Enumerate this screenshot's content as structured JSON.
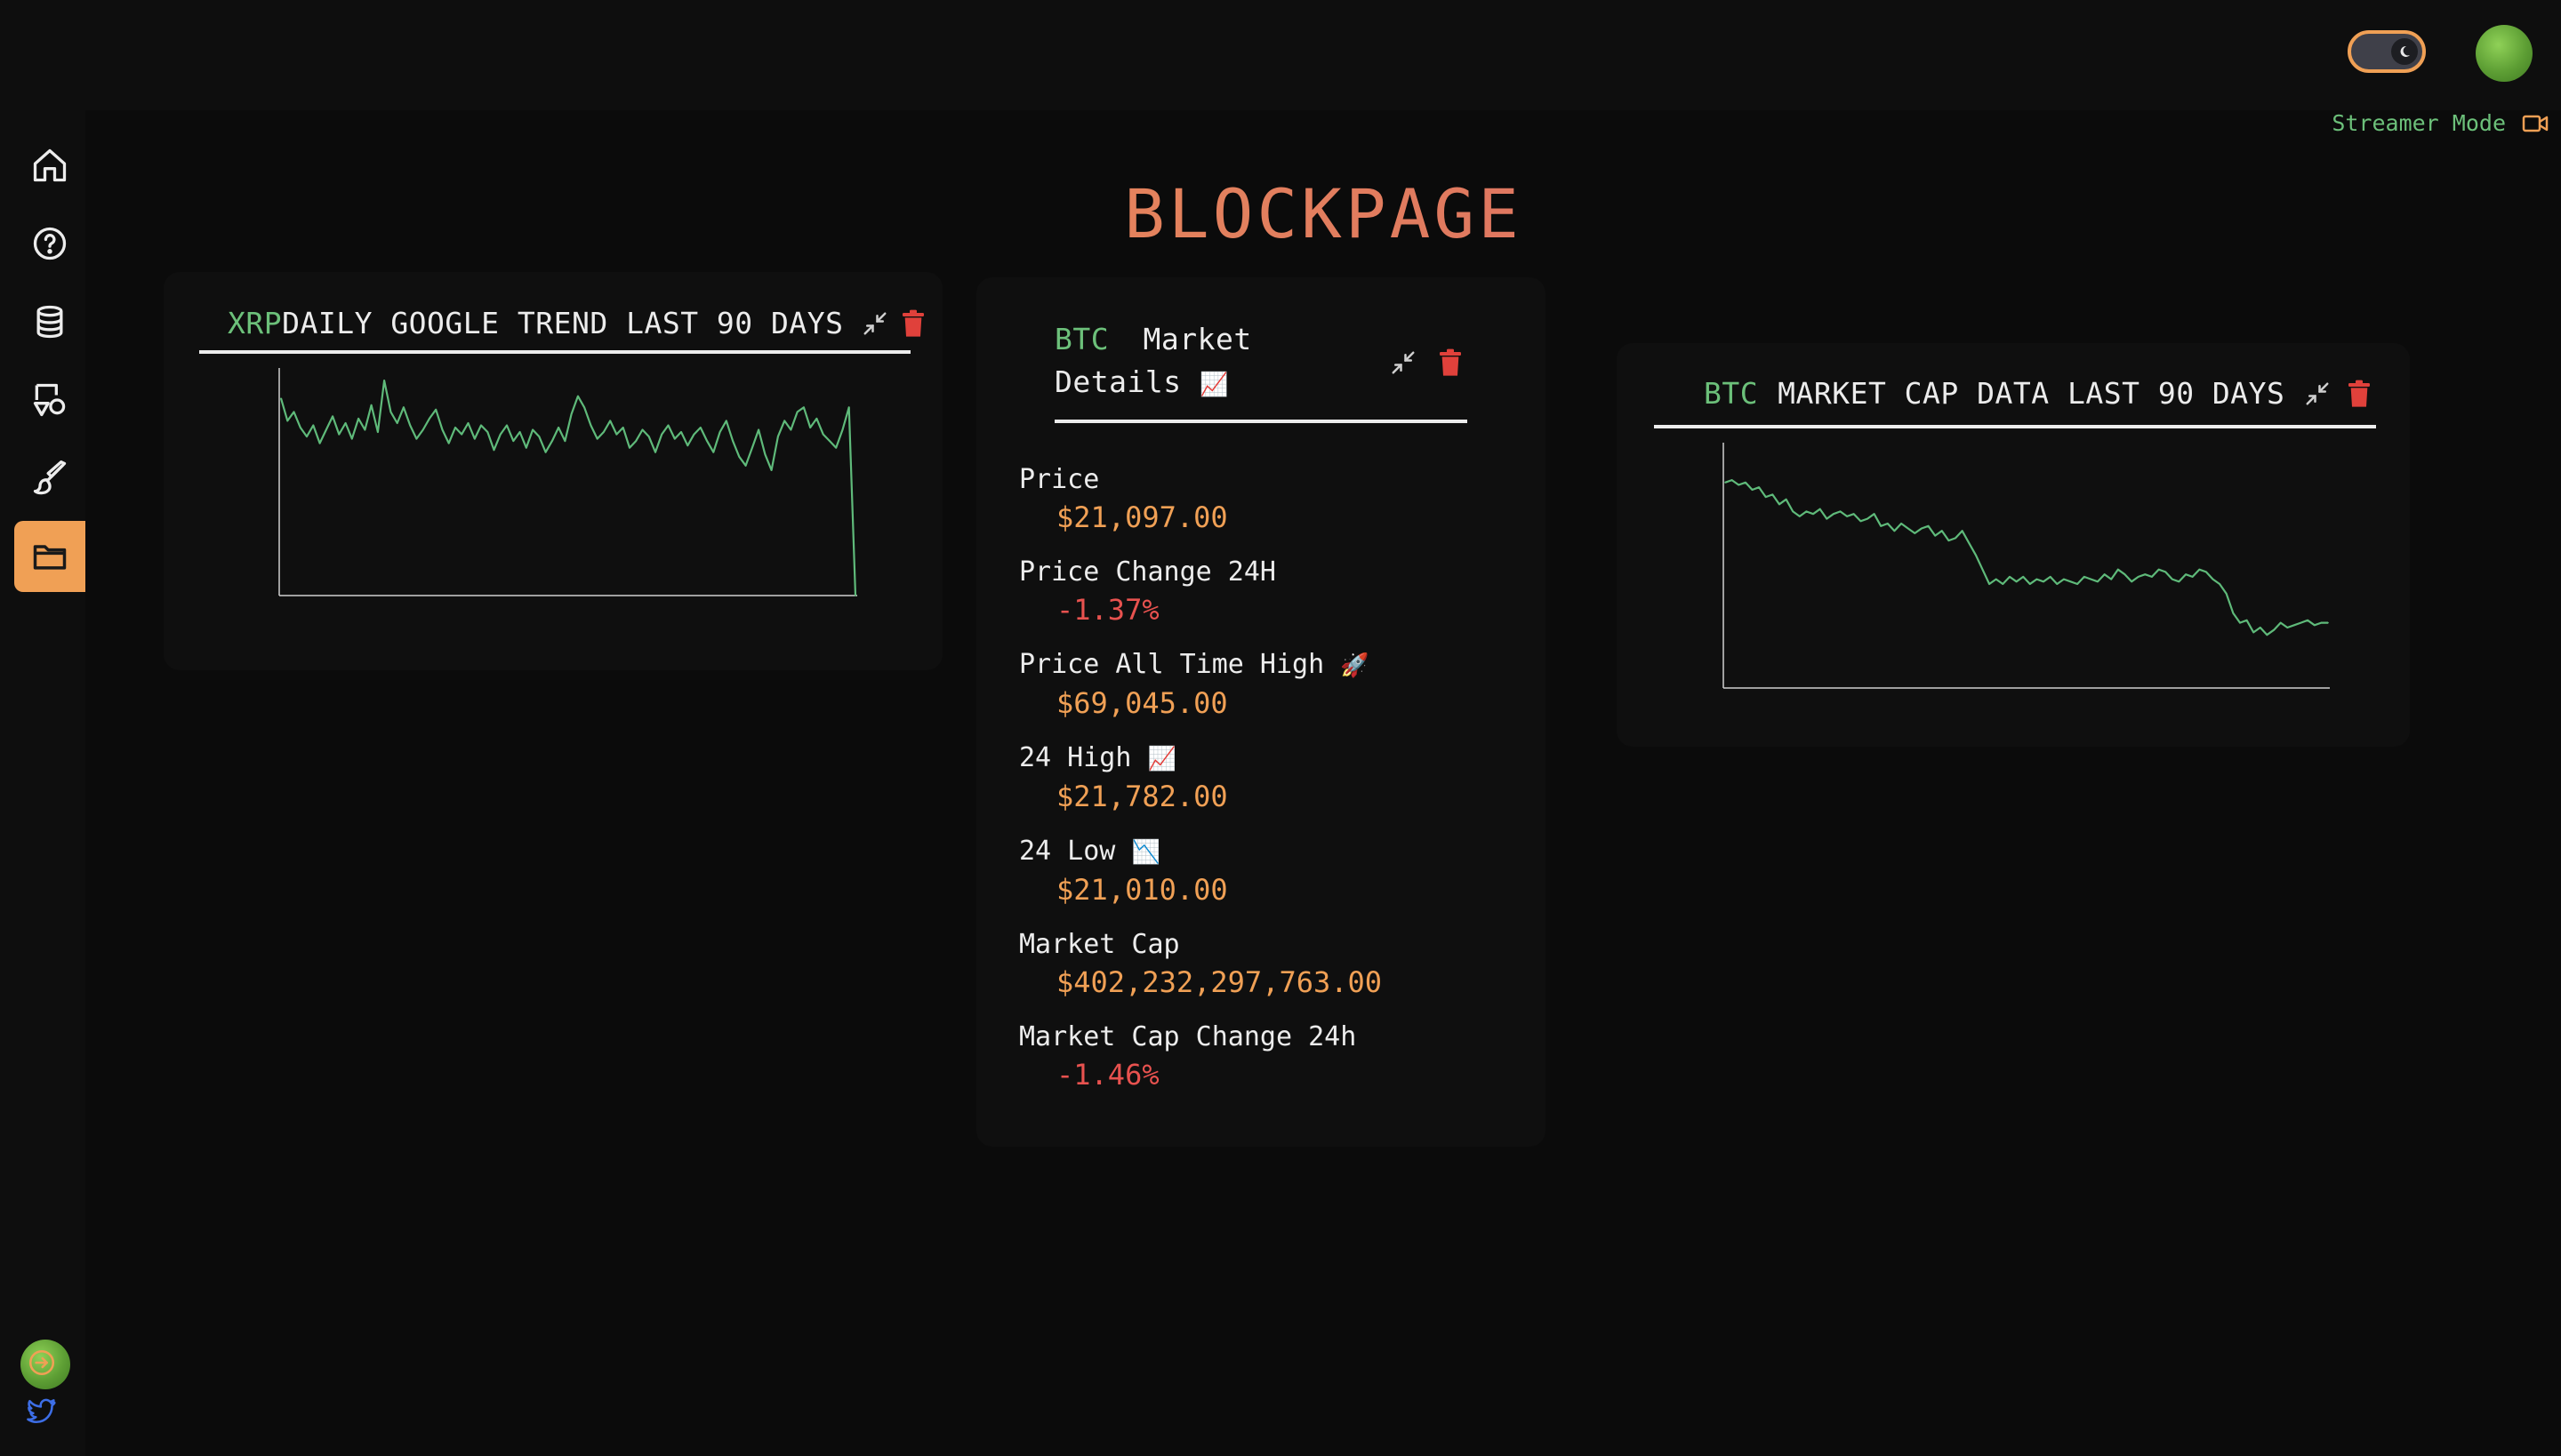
{
  "app": {
    "title": "BLOCKPAGE",
    "streamer_mode_label": "Streamer Mode"
  },
  "sidebar": {
    "items": [
      {
        "icon": "home-icon"
      },
      {
        "icon": "help-icon"
      },
      {
        "icon": "database-icon"
      },
      {
        "icon": "shapes-icon"
      },
      {
        "icon": "brush-icon"
      },
      {
        "icon": "folder-icon",
        "active": true
      }
    ],
    "bottom": [
      {
        "icon": "avatar"
      },
      {
        "icon": "logout-icon"
      },
      {
        "icon": "twitter-icon"
      }
    ]
  },
  "cards": {
    "trend": {
      "symbol": "XRP",
      "title": "DAILY GOOGLE TREND LAST 90 DAYS"
    },
    "details": {
      "symbol": "BTC",
      "title_line1": "Market",
      "title_line2": "Details",
      "title_emoji": "📈",
      "rows": [
        {
          "label": "Price",
          "emoji": "",
          "value": "$21,097.00",
          "negative": false
        },
        {
          "label": "Price Change 24H",
          "emoji": "",
          "value": "-1.37%",
          "negative": true
        },
        {
          "label": "Price All Time High",
          "emoji": "🚀",
          "value": "$69,045.00",
          "negative": false
        },
        {
          "label": "24 High",
          "emoji": "📈",
          "value": "$21,782.00",
          "negative": false
        },
        {
          "label": "24 Low",
          "emoji": "📉",
          "value": "$21,010.00",
          "negative": false
        },
        {
          "label": "Market Cap",
          "emoji": "",
          "value": "$402,232,297,763.00",
          "negative": false
        },
        {
          "label": "Market Cap Change 24h",
          "emoji": "",
          "value": "-1.46%",
          "negative": true
        }
      ]
    },
    "mcap": {
      "symbol": "BTC",
      "title": "MARKET CAP DATA LAST 90 DAYS"
    }
  },
  "colors": {
    "accent": "#f0a055",
    "positive": "#6cc07a",
    "negative": "#e8524f",
    "trash": "#e0413b",
    "background": "#0b0b0b",
    "panel": "#0f0f0f"
  },
  "chart_data": [
    {
      "type": "line",
      "title": "XRP DAILY GOOGLE TREND LAST 90 DAYS",
      "xlabel": "",
      "ylabel": "",
      "grid": false,
      "x": [
        1,
        2,
        3,
        4,
        5,
        6,
        7,
        8,
        9,
        10,
        11,
        12,
        13,
        14,
        15,
        16,
        17,
        18,
        19,
        20,
        21,
        22,
        23,
        24,
        25,
        26,
        27,
        28,
        29,
        30,
        31,
        32,
        33,
        34,
        35,
        36,
        37,
        38,
        39,
        40,
        41,
        42,
        43,
        44,
        45,
        46,
        47,
        48,
        49,
        50,
        51,
        52,
        53,
        54,
        55,
        56,
        57,
        58,
        59,
        60,
        61,
        62,
        63,
        64,
        65,
        66,
        67,
        68,
        69,
        70,
        71,
        72,
        73,
        74,
        75,
        76,
        77,
        78,
        79,
        80,
        81,
        82,
        83,
        84,
        85,
        86,
        87,
        88,
        89,
        90
      ],
      "values": [
        88,
        78,
        82,
        75,
        71,
        76,
        68,
        74,
        80,
        72,
        77,
        70,
        79,
        74,
        85,
        73,
        96,
        82,
        77,
        84,
        76,
        70,
        74,
        79,
        83,
        74,
        68,
        75,
        72,
        77,
        70,
        76,
        73,
        65,
        72,
        76,
        69,
        73,
        66,
        74,
        71,
        64,
        69,
        75,
        69,
        81,
        89,
        84,
        76,
        70,
        73,
        78,
        72,
        75,
        66,
        69,
        74,
        71,
        64,
        72,
        76,
        70,
        73,
        67,
        72,
        75,
        69,
        64,
        73,
        78,
        69,
        62,
        58,
        66,
        74,
        63,
        56,
        71,
        78,
        74,
        82,
        84,
        75,
        79,
        72,
        69,
        66,
        74,
        84,
        0
      ],
      "ylim": [
        0,
        100
      ]
    },
    {
      "type": "line",
      "title": "BTC MARKET CAP DATA LAST 90 DAYS",
      "xlabel": "",
      "ylabel": "",
      "grid": false,
      "x": [
        1,
        2,
        3,
        4,
        5,
        6,
        7,
        8,
        9,
        10,
        11,
        12,
        13,
        14,
        15,
        16,
        17,
        18,
        19,
        20,
        21,
        22,
        23,
        24,
        25,
        26,
        27,
        28,
        29,
        30,
        31,
        32,
        33,
        34,
        35,
        36,
        37,
        38,
        39,
        40,
        41,
        42,
        43,
        44,
        45,
        46,
        47,
        48,
        49,
        50,
        51,
        52,
        53,
        54,
        55,
        56,
        57,
        58,
        59,
        60,
        61,
        62,
        63,
        64,
        65,
        66,
        67,
        68,
        69,
        70,
        71,
        72,
        73,
        74,
        75,
        76,
        77,
        78,
        79,
        80,
        81,
        82,
        83,
        84,
        85,
        86,
        87,
        88,
        89,
        90
      ],
      "values": [
        85,
        86,
        84,
        85,
        82,
        83,
        79,
        80,
        76,
        78,
        73,
        71,
        73,
        72,
        74,
        70,
        72,
        73,
        71,
        72,
        69,
        70,
        72,
        67,
        68,
        65,
        68,
        66,
        64,
        66,
        67,
        63,
        65,
        61,
        62,
        65,
        60,
        55,
        49,
        43,
        45,
        43,
        46,
        44,
        46,
        43,
        45,
        44,
        46,
        43,
        45,
        44,
        43,
        46,
        45,
        44,
        47,
        45,
        49,
        47,
        44,
        46,
        47,
        46,
        49,
        48,
        45,
        44,
        47,
        46,
        49,
        48,
        45,
        43,
        39,
        31,
        27,
        28,
        23,
        25,
        22,
        24,
        27,
        25,
        26,
        27,
        28,
        26,
        27,
        27
      ],
      "ylim": [
        0,
        100
      ]
    }
  ]
}
